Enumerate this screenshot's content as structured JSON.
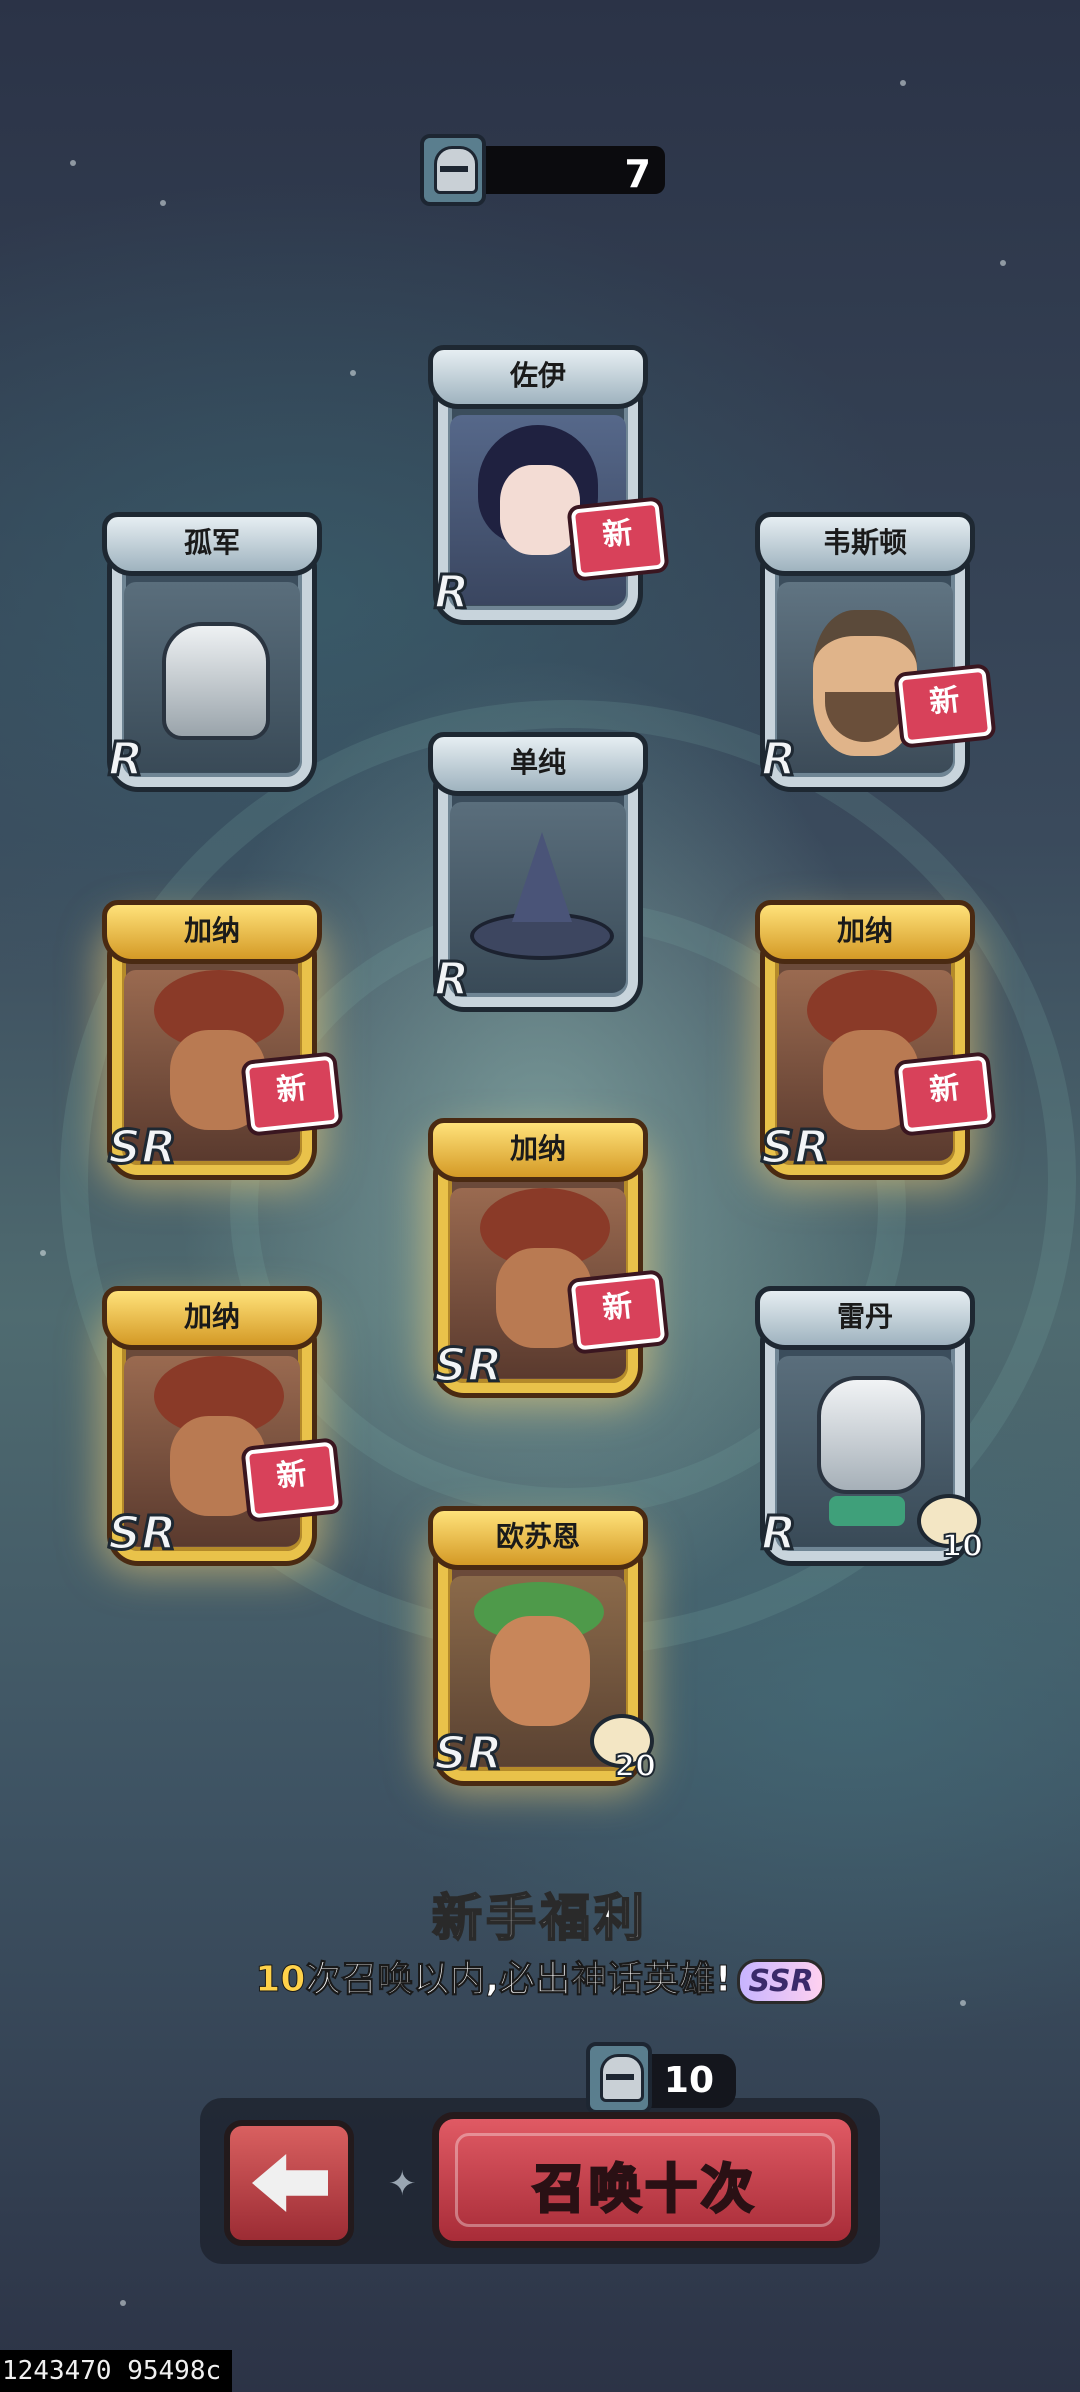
{
  "currency": {
    "icon": "helmet-ticket-icon",
    "amount": "7"
  },
  "cards": [
    {
      "name": "佐伊",
      "rarity": "R",
      "new": "新",
      "dup": "",
      "art": "art-girl",
      "tier": "r"
    },
    {
      "name": "孤军",
      "rarity": "R",
      "new": "",
      "dup": "",
      "art": "art-helmet",
      "tier": "r"
    },
    {
      "name": "韦斯顿",
      "rarity": "R",
      "new": "新",
      "dup": "",
      "art": "art-man",
      "tier": "r"
    },
    {
      "name": "单纯",
      "rarity": "R",
      "new": "",
      "dup": "",
      "art": "art-hat",
      "tier": "r"
    },
    {
      "name": "加纳",
      "rarity": "SR",
      "new": "新",
      "dup": "",
      "art": "art-jana",
      "tier": "sr"
    },
    {
      "name": "加纳",
      "rarity": "SR",
      "new": "新",
      "dup": "",
      "art": "art-jana",
      "tier": "sr"
    },
    {
      "name": "加纳",
      "rarity": "SR",
      "new": "新",
      "dup": "",
      "art": "art-jana",
      "tier": "sr"
    },
    {
      "name": "加纳",
      "rarity": "SR",
      "new": "新",
      "dup": "",
      "art": "art-jana",
      "tier": "sr"
    },
    {
      "name": "雷丹",
      "rarity": "R",
      "new": "",
      "dup": "10",
      "art": "art-knight",
      "tier": "r"
    },
    {
      "name": "欧苏恩",
      "rarity": "SR",
      "new": "",
      "dup": "20",
      "art": "art-oscn",
      "tier": "sr"
    }
  ],
  "promo": {
    "title": "新手福利",
    "highlight": "10",
    "text": "次召唤以内,必出神话英雄!",
    "badge": "SSR"
  },
  "summon": {
    "cost": "10",
    "label": "召唤十次",
    "cost_icon": "helmet-ticket-icon"
  },
  "back_icon": "back-arrow-icon",
  "footer_id": "1243470 95498c",
  "colors": {
    "sr_gold": "#e9c24a",
    "button_red": "#d04a55",
    "tag_red": "#d8415a"
  }
}
